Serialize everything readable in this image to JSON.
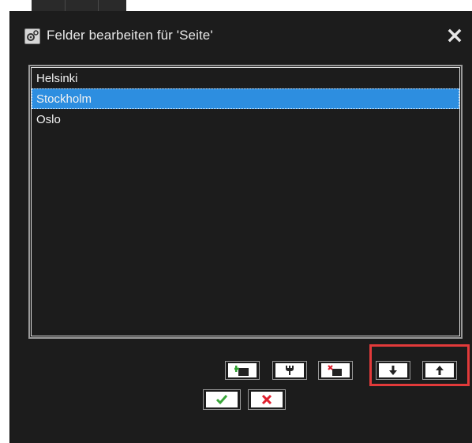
{
  "dialog": {
    "title": "Felder bearbeiten für 'Seite'"
  },
  "list": {
    "items": [
      {
        "label": "Helsinki",
        "selected": false
      },
      {
        "label": "Stockholm",
        "selected": true
      },
      {
        "label": "Oslo",
        "selected": false
      }
    ]
  },
  "toolbar": {
    "icons": [
      "add-field-icon",
      "edit-field-icon",
      "delete-field-icon",
      "move-down-icon",
      "move-up-icon"
    ]
  },
  "colors": {
    "dialog_bg": "#1c1c1c",
    "selection": "#2d8ee0",
    "highlight": "#e23a3a",
    "ok_green": "#3aa63a",
    "cancel_red": "#e01f2d"
  }
}
